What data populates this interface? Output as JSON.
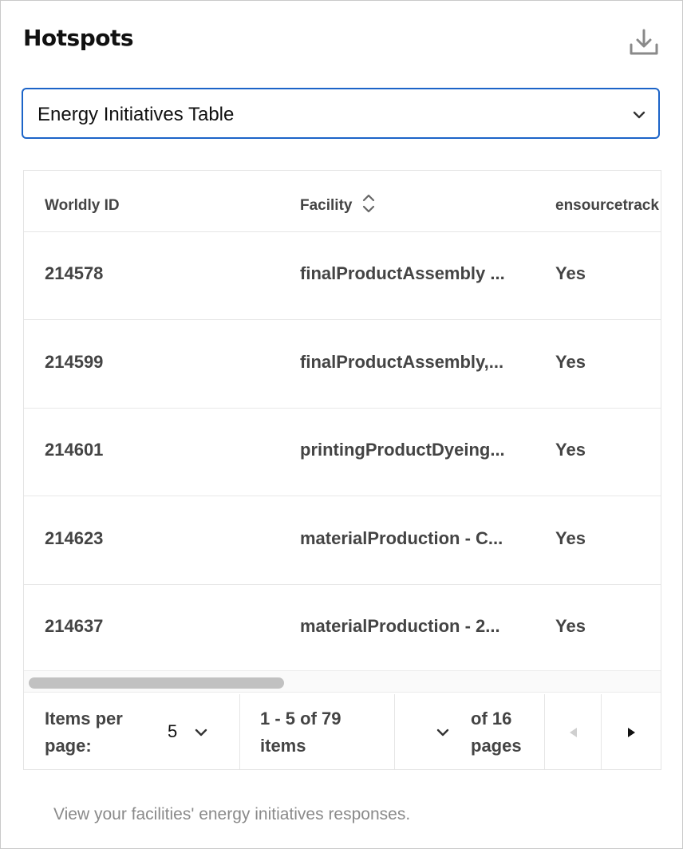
{
  "card": {
    "title": "Hotspots",
    "download_icon": "download-icon"
  },
  "selector": {
    "value": "Energy Initiatives Table",
    "icon": "chevron-down-icon"
  },
  "table": {
    "columns": [
      "Worldly ID",
      "Facility",
      "ensourcetrack"
    ],
    "sortable_column_icon": "sort-icon",
    "rows": [
      [
        "214578",
        "finalProductAssembly ...",
        "Yes"
      ],
      [
        "214599",
        "finalProductAssembly,...",
        "Yes"
      ],
      [
        "214601",
        "printingProductDyeing...",
        "Yes"
      ],
      [
        "214623",
        "materialProduction - C...",
        "Yes"
      ],
      [
        "214637",
        "materialProduction - 2...",
        "Yes"
      ]
    ]
  },
  "pagination": {
    "items_per_page_label_1": "Items per",
    "items_per_page_label_2": "page:",
    "items_per_page_value": "5",
    "range_line_1": "1 - 5 of 79",
    "range_line_2": "items",
    "pages_line_1": "of 16",
    "pages_line_2": "pages",
    "prev_icon": "caret-left-icon",
    "next_icon": "caret-right-icon"
  },
  "footnote": "View your facilities' energy initiatives responses."
}
